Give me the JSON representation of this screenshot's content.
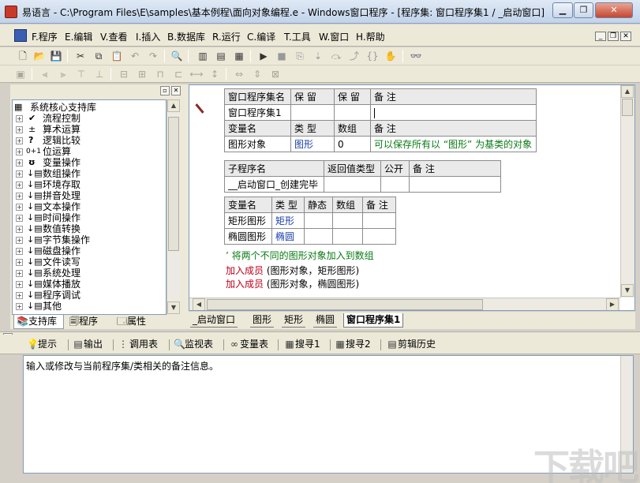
{
  "window": {
    "title": "易语言 - C:\\Program Files\\E\\samples\\基本例程\\面向对象编程.e - Windows窗口程序 - [程序集: 窗口程序集1 / _启动窗口]"
  },
  "menu": [
    "F.程序",
    "E.编辑",
    "V.查看",
    "I.插入",
    "B.数据库",
    "R.运行",
    "C.编译",
    "T.工具",
    "W.窗口",
    "H.帮助"
  ],
  "toolbar": {
    "icons": [
      "new-file-icon",
      "open-file-icon",
      "save-icon",
      "cut-icon",
      "copy-icon",
      "paste-icon",
      "undo-icon",
      "redo-icon",
      "find-icon",
      "layout1-icon",
      "layout2-icon",
      "layout3-icon",
      "run-icon",
      "stop-icon",
      "step-icon",
      "step-into-icon",
      "step-over-icon",
      "step-out-icon",
      "run-to-cursor-icon",
      "hand-icon",
      "binoculars-icon"
    ]
  },
  "support_panel": {
    "tree": [
      {
        "label": "系统核心支持库",
        "icon": "library-icon"
      },
      {
        "label": "流程控制",
        "icon": "check-icon"
      },
      {
        "label": "算术运算",
        "icon": "math-icon"
      },
      {
        "label": "逻辑比较",
        "icon": "question-icon"
      },
      {
        "label": "位运算",
        "icon": "bit-icon"
      },
      {
        "label": "变量操作",
        "icon": "variable-icon"
      },
      {
        "label": "数组操作",
        "icon": "command-icon"
      },
      {
        "label": "环境存取",
        "icon": "command-icon"
      },
      {
        "label": "拼音处理",
        "icon": "command-icon"
      },
      {
        "label": "文本操作",
        "icon": "command-icon"
      },
      {
        "label": "时间操作",
        "icon": "command-icon"
      },
      {
        "label": "数值转换",
        "icon": "command-icon"
      },
      {
        "label": "字节集操作",
        "icon": "command-icon"
      },
      {
        "label": "磁盘操作",
        "icon": "command-icon"
      },
      {
        "label": "文件读写",
        "icon": "command-icon"
      },
      {
        "label": "系统处理",
        "icon": "command-icon"
      },
      {
        "label": "媒体播放",
        "icon": "command-icon"
      },
      {
        "label": "程序调试",
        "icon": "command-icon"
      },
      {
        "label": "其他",
        "icon": "command-icon"
      }
    ],
    "tabs": [
      "支持库",
      "程序",
      "属性"
    ]
  },
  "editor": {
    "assembly_table": {
      "headers": [
        "窗口程序集名",
        "保 留",
        "保 留",
        "备 注"
      ],
      "row": [
        "窗口程序集1",
        "",
        "",
        ""
      ],
      "var_headers": [
        "变量名",
        "类 型",
        "数组",
        "备 注"
      ],
      "var_row": [
        "图形对象",
        "图形",
        "0",
        "可以保存所有以 “图形” 为基类的对象"
      ]
    },
    "sub_table": {
      "headers": [
        "子程序名",
        "返回值类型",
        "公开",
        "备 注"
      ],
      "row": [
        "__启动窗口_创建完毕",
        "",
        "",
        ""
      ]
    },
    "local_vars": {
      "headers": [
        "变量名",
        "类 型",
        "静态",
        "数组",
        "备 注"
      ],
      "rows": [
        [
          "矩形图形",
          "矩形",
          "",
          "",
          ""
        ],
        [
          "椭圆图形",
          "椭圆",
          "",
          "",
          ""
        ]
      ]
    },
    "code_lines": [
      {
        "kind": "comment",
        "text": "’ 将两个不同的图形对象加入到数组"
      },
      {
        "kind": "call",
        "keyword": "加入成员",
        "args": " (图形对象，矩形图形)"
      },
      {
        "kind": "call",
        "keyword": "加入成员",
        "args": " (图形对象，椭圆图形)"
      }
    ]
  },
  "doc_tabs": [
    "_启动窗口",
    "图形",
    "矩形",
    "椭圆",
    "窗口程序集1"
  ],
  "output_panel": {
    "tabs": [
      {
        "label": "提示",
        "icon": "hint-icon"
      },
      {
        "label": "输出",
        "icon": "output-icon"
      },
      {
        "label": "调用表",
        "icon": "call-stack-icon"
      },
      {
        "label": "监视表",
        "icon": "watch-icon"
      },
      {
        "label": "变量表",
        "icon": "variables-icon"
      },
      {
        "label": "搜寻1",
        "icon": "search1-icon"
      },
      {
        "label": "搜寻2",
        "icon": "search2-icon"
      },
      {
        "label": "剪辑历史",
        "icon": "clipboard-icon"
      }
    ],
    "message": "输入或修改与当前程序集/类相关的备注信息。"
  },
  "watermark": "下载吧"
}
